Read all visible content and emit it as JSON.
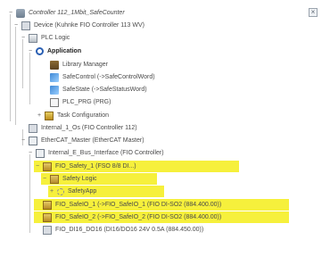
{
  "tree": {
    "rows": [
      {
        "toggle": "−",
        "icon": "project-icon",
        "label": "Controller 112_1Mbit_SafeCounter",
        "highlight": false
      },
      {
        "toggle": "−",
        "icon": "device-icon",
        "label": "Device (Kuhnke FIO Controller 113 WV)",
        "highlight": false
      },
      {
        "toggle": "−",
        "icon": "plc-logic-icon",
        "label": "PLC Logic",
        "highlight": false
      },
      {
        "toggle": "−",
        "icon": "application-icon",
        "label": "Application",
        "highlight": false
      },
      {
        "toggle": "",
        "icon": "library-icon",
        "label": "Library Manager",
        "highlight": false
      },
      {
        "toggle": "",
        "icon": "safe-icon",
        "label": "SafeControl (->SafeControlWord)",
        "highlight": false
      },
      {
        "toggle": "",
        "icon": "safe-icon",
        "label": "SafeState (->SafeStatusWord)",
        "highlight": false
      },
      {
        "toggle": "",
        "icon": "document-icon",
        "label": "PLC_PRG (PRG)",
        "highlight": false
      },
      {
        "toggle": "+",
        "icon": "task-icon",
        "label": "Task Configuration",
        "highlight": false
      },
      {
        "toggle": "",
        "icon": "device-icon",
        "label": "Internal_1_Os (FIO Controller 112)",
        "highlight": false
      },
      {
        "toggle": "−",
        "icon": "network-icon",
        "label": "EtherCAT_Master (EtherCAT Master)",
        "highlight": false
      },
      {
        "toggle": "−",
        "icon": "network-icon",
        "label": "Internal_E_Bus_Interface (FIO Controller)",
        "highlight": false
      },
      {
        "toggle": "−",
        "icon": "fso-icon",
        "label": "FIO_Safety_1 (FSO 8/8 DI...)",
        "highlight": true
      },
      {
        "toggle": "−",
        "icon": "logic-icon",
        "label": "Safety Logic",
        "highlight": true
      },
      {
        "toggle": "+",
        "icon": "dots-icon",
        "label": "SafetyApp",
        "highlight": true
      },
      {
        "toggle": "",
        "icon": "fso-icon",
        "label": "FIO_SafeIO_1 (->FIO_SafeIO_1 (FIO DI-SO2 (884.400.00))",
        "highlight": true
      },
      {
        "toggle": "",
        "icon": "fso-icon",
        "label": "FIO_SafeIO_2 (->FIO_SafeIO_2 (FIO DI-SO2 (884.400.00))",
        "highlight": true
      },
      {
        "toggle": "",
        "icon": "device-icon",
        "label": "FIO_DI16_DO16 (DI16/DO16 24V 0.5A (884.450.00))",
        "highlight": false
      }
    ]
  },
  "close_label": "×"
}
